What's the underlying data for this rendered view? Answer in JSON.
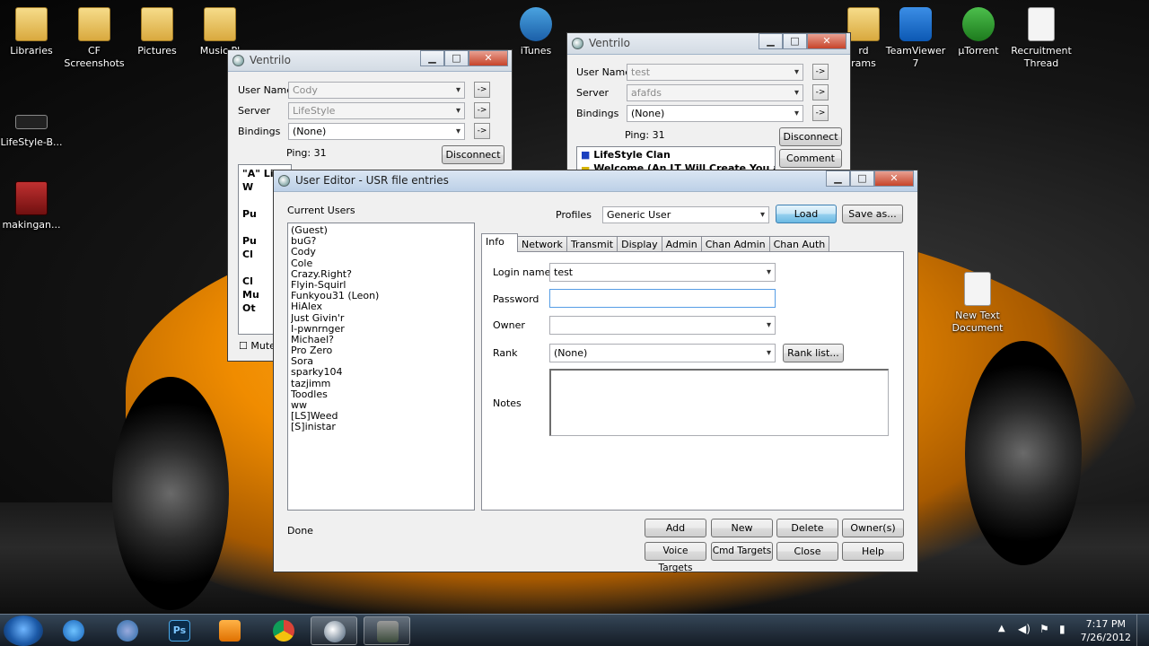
{
  "desktop": {
    "icons": [
      {
        "label": "Libraries",
        "icon": "libraries-folder-icon"
      },
      {
        "label": "CF\nScreenshots",
        "icon": "folder-icon"
      },
      {
        "label": "Pictures",
        "icon": "folder-icon"
      },
      {
        "label": "Music Pl",
        "icon": "folder-icon"
      },
      {
        "label": "iTunes",
        "icon": "itunes-icon"
      },
      {
        "label": "TeamViewer\n7",
        "icon": "teamviewer-icon"
      },
      {
        "label": "µTorrent",
        "icon": "utorrent-icon"
      },
      {
        "label": "Recruitment\nThread",
        "icon": "text-document-icon"
      },
      {
        "label": "LifeStyle-B...",
        "icon": "shortcut-icon"
      },
      {
        "label": "makingan...",
        "icon": "video-file-icon"
      },
      {
        "label": "New Text\nDocument",
        "icon": "text-document-icon"
      },
      {
        "label": "rd\nrams",
        "icon": "folder-icon"
      }
    ]
  },
  "ventrilo_left": {
    "title": "Ventrilo",
    "user_name_label": "User Name",
    "user_name_value": "Cody",
    "server_label": "Server",
    "server_value": "LifeStyle",
    "bindings_label": "Bindings",
    "bindings_value": "(None)",
    "ping": "Ping: 31",
    "disconnect": "Disconnect",
    "mute": "Mute",
    "tree": [
      "\"A\" LifeStyle Cl",
      "W",
      "",
      "Pu",
      "",
      "Pu",
      "Cl",
      "",
      "Cl",
      "Mu",
      "Ot"
    ]
  },
  "ventrilo_right": {
    "title": "Ventrilo",
    "user_name_label": "User Name",
    "user_name_value": "test",
    "server_label": "Server",
    "server_value": "afafds",
    "bindings_label": "Bindings",
    "bindings_value": "(None)",
    "ping": "Ping: 31",
    "disconnect": "Disconnect",
    "comment": "Comment",
    "tree": [
      "LifeStyle Clan",
      "Welcome (An LT Will Create You a"
    ]
  },
  "user_editor": {
    "title": "User Editor - USR file entries",
    "current_users_label": "Current Users",
    "users": [
      "(Guest)",
      "buG?",
      "Cody",
      "Cole",
      "Crazy.Right?",
      "Flyin-Squirl",
      "Funkyou31 (Leon)",
      "HiAlex",
      "Just Givin'r",
      "I-pwnrnger",
      "Michael?",
      "Pro Zero",
      "Sora",
      "sparky104",
      "tazjimm",
      "Toodles",
      "ww",
      "[LS]Weed",
      "[S]inistar"
    ],
    "profiles_label": "Profiles",
    "profiles_value": "Generic User",
    "load": "Load",
    "save_as": "Save as...",
    "tabs": [
      "Info",
      "Network",
      "Transmit",
      "Display",
      "Admin",
      "Chan Admin",
      "Chan Auth"
    ],
    "active_tab": "Info",
    "login_name_label": "Login name",
    "login_name_value": "test",
    "password_label": "Password",
    "password_value": "",
    "owner_label": "Owner",
    "owner_value": "",
    "rank_label": "Rank",
    "rank_value": "(None)",
    "rank_list": "Rank list...",
    "notes_label": "Notes",
    "notes_value": "",
    "status": "Done",
    "buttons": {
      "add": "Add",
      "new": "New",
      "delete": "Delete",
      "owners": "Owner(s)",
      "voice_targets": "Voice Targets",
      "cmd_targets": "Cmd Targets",
      "close": "Close",
      "help": "Help"
    }
  },
  "taskbar": {
    "items": [
      "start-orb-icon",
      "internet-explorer-icon",
      "itunes-icon",
      "photoshop-icon",
      "media-player-icon",
      "chrome-icon",
      "ventrilo-icon",
      "game-icon"
    ],
    "time": "7:17 PM",
    "date": "7/26/2012"
  }
}
